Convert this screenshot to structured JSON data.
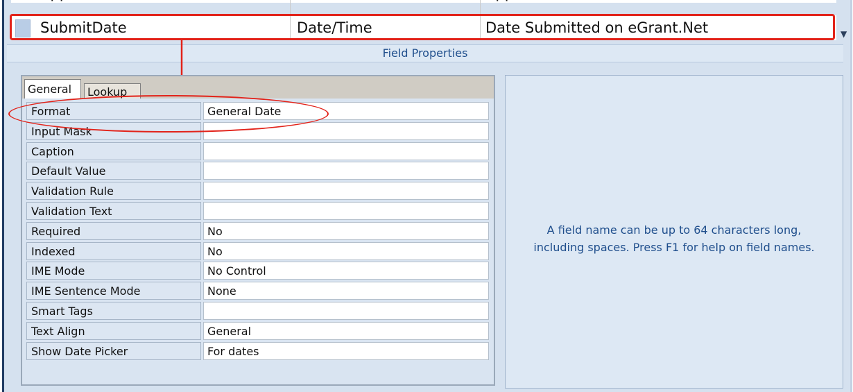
{
  "grid": {
    "partial_row": {
      "name": "ApplicationID",
      "type": "Number",
      "description": "ApplicationID from eGrant.Net"
    },
    "selected_row": {
      "name": "SubmitDate",
      "type": "Date/Time",
      "description": "Date Submitted on eGrant.Net"
    }
  },
  "field_properties": {
    "title": "Field Properties",
    "tabs": [
      "General",
      "Lookup"
    ],
    "active_tab": "General",
    "properties": [
      {
        "name": "Format",
        "value": "General Date"
      },
      {
        "name": "Input Mask",
        "value": ""
      },
      {
        "name": "Caption",
        "value": ""
      },
      {
        "name": "Default Value",
        "value": ""
      },
      {
        "name": "Validation Rule",
        "value": ""
      },
      {
        "name": "Validation Text",
        "value": ""
      },
      {
        "name": "Required",
        "value": "No"
      },
      {
        "name": "Indexed",
        "value": "No"
      },
      {
        "name": "IME Mode",
        "value": "No Control"
      },
      {
        "name": "IME Sentence Mode",
        "value": "None"
      },
      {
        "name": "Smart Tags",
        "value": ""
      },
      {
        "name": "Text Align",
        "value": "General"
      },
      {
        "name": "Show Date Picker",
        "value": "For dates"
      }
    ]
  },
  "help": {
    "line1": "A field name can be up to 64 characters long,",
    "line2": "including spaces.  Press F1 for help on field names."
  },
  "colors": {
    "annotation": "#e2231a",
    "accent_text": "#1f4e8c"
  }
}
